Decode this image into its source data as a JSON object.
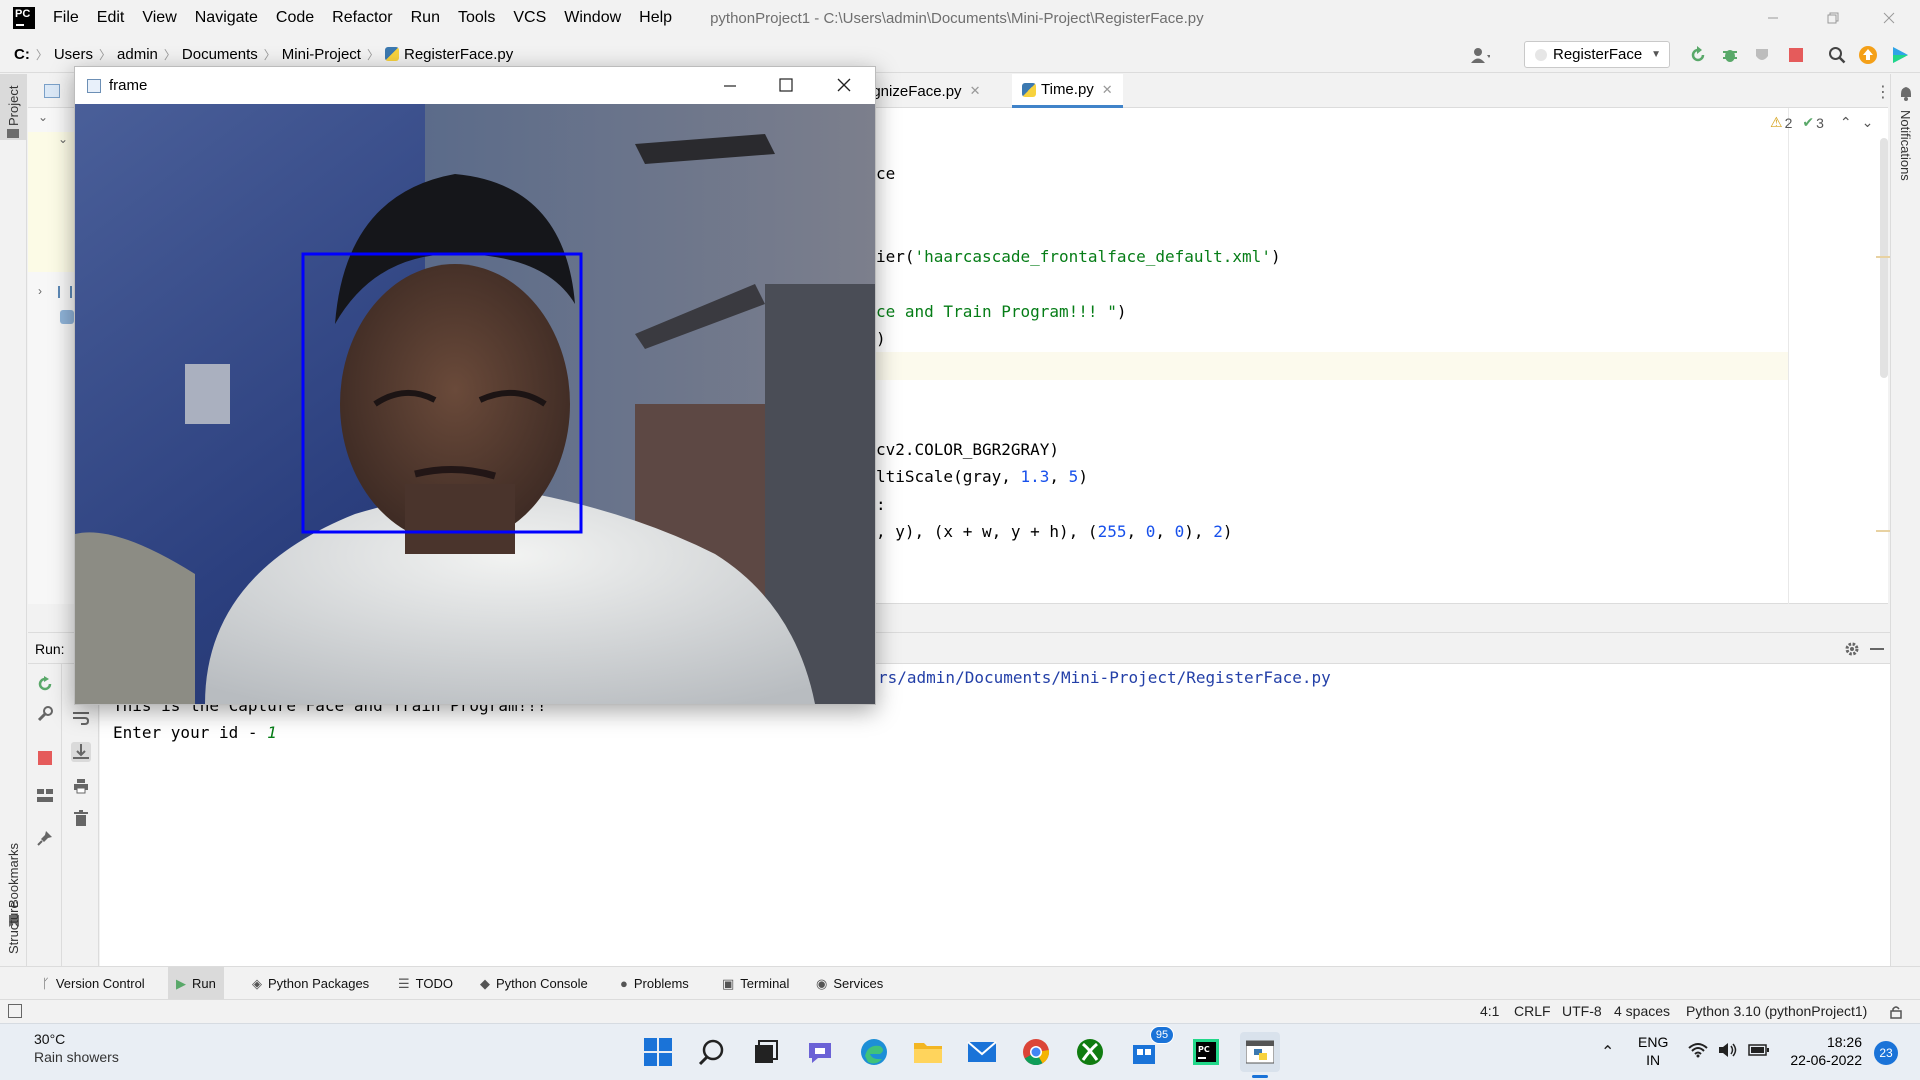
{
  "menubar": {
    "items": [
      "File",
      "Edit",
      "View",
      "Navigate",
      "Code",
      "Refactor",
      "Run",
      "Tools",
      "VCS",
      "Window",
      "Help"
    ],
    "window_title": "pythonProject1 - C:\\Users\\admin\\Documents\\Mini-Project\\RegisterFace.py"
  },
  "navbar": {
    "drive": "C:",
    "crumbs": [
      "Users",
      "admin",
      "Documents",
      "Mini-Project",
      "RegisterFace.py"
    ],
    "run_config": "RegisterFace"
  },
  "left_strip": {
    "project_label": "Project",
    "bookmarks_label": "Bookmarks",
    "structure_label": "Structure"
  },
  "right_strip": {
    "notifications_label": "Notifications"
  },
  "editor": {
    "tabs": [
      {
        "label": "ognizeFace.py"
      },
      {
        "label": "Time.py"
      }
    ],
    "warnings_count": "2",
    "checks_count": "3",
    "code": {
      "l1": "ce",
      "l2a": "ier(",
      "l2b": "'haarcascade_frontalface_default.xml'",
      "l2c": ")",
      "l3a": "ce and Train Program!!! \"",
      "l3b": ")",
      "l4": ")",
      "l5": "cv2.COLOR_BGR2GRAY)",
      "l6a": "ltiScale(gray, ",
      "l6b": "1.3",
      "l6c": ", ",
      "l6d": "5",
      "l6e": ")",
      "l7": ":",
      "l8a": ", y), (x + w, y + h), (",
      "l8b": "255",
      "l8c": ", ",
      "l8d": "0",
      "l8e": ", ",
      "l8f": "0",
      "l8g": "), ",
      "l8h": "2",
      "l8i": ")"
    }
  },
  "run_panel": {
    "label": "Run:",
    "path_fragment": "rs/admin/Documents/Mini-Project/RegisterFace.py",
    "line1": "This is the Capture Face and Train Program!!!",
    "line2_prefix": "Enter your id - ",
    "line2_input": "1"
  },
  "tool_windows": [
    "Version Control",
    "Run",
    "Python Packages",
    "TODO",
    "Python Console",
    "Problems",
    "Terminal",
    "Services"
  ],
  "status_bar": {
    "position": "4:1",
    "line_sep": "CRLF",
    "encoding": "UTF-8",
    "indent": "4 spaces",
    "interpreter": "Python 3.10 (pythonProject1)"
  },
  "frame_window": {
    "title": "frame"
  },
  "taskbar": {
    "weather_temp": "30°C",
    "weather_desc": "Rain showers",
    "lang_1": "ENG",
    "lang_2": "IN",
    "time": "18:26",
    "date": "22-06-2022",
    "notification_count": "23",
    "store_badge": "95"
  },
  "colors": {
    "accent_blue": "#4083c9",
    "string_green": "#067d17",
    "number_blue": "#1750eb",
    "face_box": "#0000ff",
    "stop_red": "#e55b5b",
    "run_green": "#59a869"
  }
}
